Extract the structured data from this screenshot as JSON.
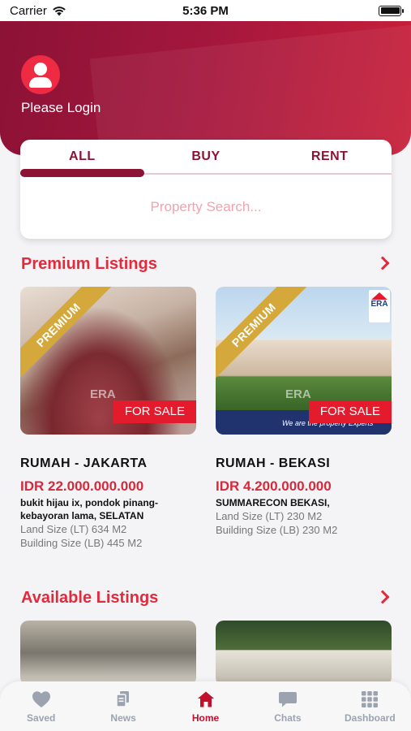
{
  "status_bar": {
    "carrier": "Carrier",
    "time": "5:36 PM"
  },
  "header": {
    "login_label": "Please Login"
  },
  "search": {
    "tabs": [
      {
        "label": "ALL"
      },
      {
        "label": "BUY"
      },
      {
        "label": "RENT"
      }
    ],
    "active_tab": "ALL",
    "placeholder": "Property Search..."
  },
  "premium": {
    "title": "Premium Listings",
    "listings": [
      {
        "ribbon": "PREMIUM",
        "badge": "FOR SALE",
        "watermark": "ERA",
        "title": "RUMAH - JAKARTA",
        "price": "IDR 22.000.000.000",
        "address": "bukit hijau ix, pondok pinang-kebayoran lama, SELATAN",
        "land_size": "Land Size (LT) 634 M2",
        "building_size": "Building Size (LB) 445 M2"
      },
      {
        "ribbon": "PREMIUM",
        "badge": "FOR SALE",
        "watermark": "ERA",
        "logo_text": "ERA",
        "tagline": "We are the property Experts",
        "title": "RUMAH - BEKASI",
        "price": "IDR 4.200.000.000",
        "address": "SUMMARECON BEKASI,",
        "land_size": "Land Size (LT) 230 M2",
        "building_size": "Building Size (LB) 230 M2"
      }
    ]
  },
  "available": {
    "title": "Available Listings"
  },
  "bottom_nav": {
    "active": "Home",
    "items": [
      {
        "label": "Saved",
        "icon": "heart-icon"
      },
      {
        "label": "News",
        "icon": "news-icon"
      },
      {
        "label": "Home",
        "icon": "home-icon"
      },
      {
        "label": "Chats",
        "icon": "chat-icon"
      },
      {
        "label": "Dashboard",
        "icon": "grid-icon"
      }
    ]
  },
  "colors": {
    "brand_dark": "#8c1236",
    "brand_red": "#e22a3c",
    "badge_red": "#e31b2c",
    "premium_gold": "#d4a83a",
    "nav_inactive": "#9aa3af"
  }
}
